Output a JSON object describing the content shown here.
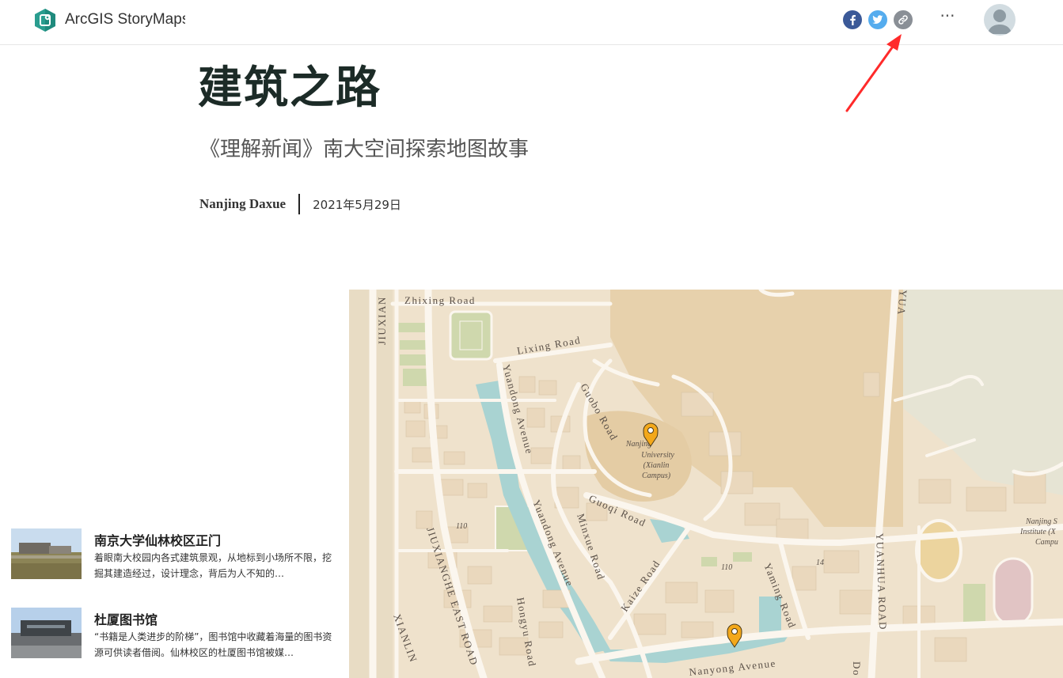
{
  "header": {
    "brand": "ArcGIS StoryMaps",
    "share_icons": [
      "facebook-icon",
      "twitter-icon",
      "link-icon"
    ],
    "more_label": "···"
  },
  "story": {
    "title": "建筑之路",
    "subtitle": "《理解新闻》南大空间探索地图故事",
    "author": "Nanjing Daxue",
    "date": "2021年5月29日"
  },
  "map": {
    "roads": {
      "zhixing": "Zhixing Road",
      "lixing": "Lixing Road",
      "yuandong": "Yuandong Avenue",
      "guobo": "Guobo Road",
      "guoqi": "Guoqi Road",
      "minxue": "Minxue Road",
      "yuandong_ave": "Yuandong Avenue",
      "kaize": "Kaize Road",
      "yaming": "Yaming Road",
      "hongyu": "Hongyu Road",
      "nanyong": "Nanyong Avenue",
      "jiuxianghe_east": "JIUXIANGHE EAST ROAD",
      "xianlin": "XIANLIN",
      "jiuxian": "JIUXIAN",
      "yuanhua": "YUANHUA ROAD",
      "yua": "YUA",
      "do": "Do",
      "n110a": "110",
      "n110b": "110",
      "n14": "14"
    },
    "poi_lines": [
      "Nanjing",
      "University",
      "(Xianlin",
      "Campus)"
    ],
    "poi2_lines": [
      "Nanjing S",
      "Institute (X",
      "Campu"
    ]
  },
  "cards": [
    {
      "title": "南京大学仙林校区正门",
      "desc": "着眼南大校园内各式建筑景观，从地标到小场所不限，挖掘其建造经过，设计理念，背后为人不知的…"
    },
    {
      "title": "杜厦图书馆",
      "desc": "“书籍是人类进步的阶梯”，图书馆中收藏着海量的图书资源可供读者借阅。仙林校区的杜厦图书馆被媒…"
    }
  ],
  "colors": {
    "facebook": "#3b5998",
    "twitter": "#55acee",
    "link": "#8a8f96",
    "map_land": "#efe2cc",
    "map_campus": "#e7d1ac",
    "map_road": "#fbf6ee",
    "map_water": "#a9d3d2",
    "map_green": "#cfd8ad",
    "marker": "#f3a81b",
    "annotation": "#ff2a2a"
  }
}
